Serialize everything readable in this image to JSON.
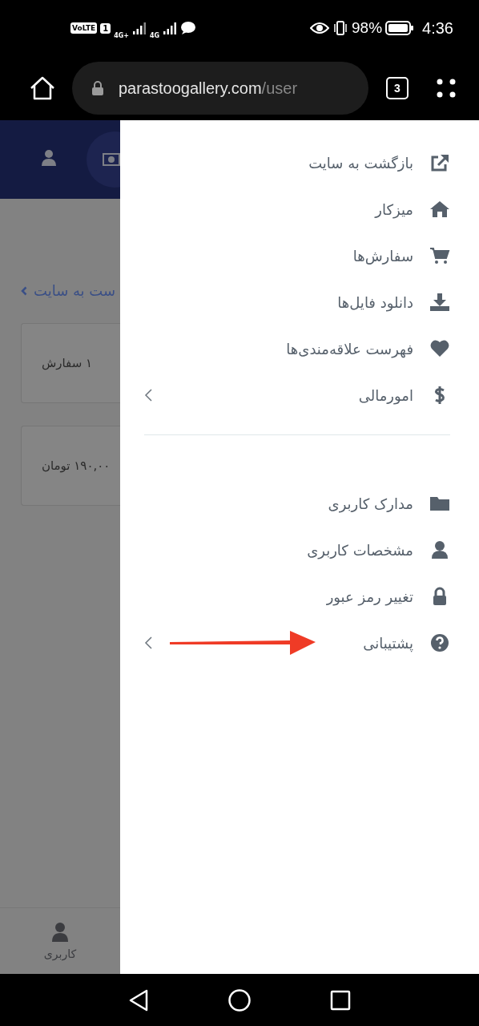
{
  "status_bar": {
    "volte": "VoLTE",
    "sim": "1",
    "network_1": "4G+",
    "network_2": "4G",
    "battery": "98%",
    "time": "4:36"
  },
  "browser": {
    "url_host": "parastoogallery.com",
    "url_path": "/user",
    "tab_count": "3"
  },
  "background_page": {
    "back_link": "ست به سایت",
    "cards": [
      "۱ سفارش",
      "۱۹۰,۰۰ تومان"
    ],
    "bottom_tab": "کاربری"
  },
  "drawer": {
    "groups": [
      {
        "items": [
          {
            "label": "بازگشت به سایت",
            "has_submenu": false
          },
          {
            "label": "میزکار",
            "has_submenu": false
          },
          {
            "label": "سفارش‌ها",
            "has_submenu": false
          },
          {
            "label": "دانلود فایل‌ها",
            "has_submenu": false
          },
          {
            "label": "فهرست علاقه‌مندی‌ها",
            "has_submenu": false
          },
          {
            "label": "امورمالی",
            "has_submenu": true
          }
        ]
      },
      {
        "items": [
          {
            "label": "مدارک کاربری",
            "has_submenu": false
          },
          {
            "label": "مشخصات کاربری",
            "has_submenu": false
          },
          {
            "label": "تغییر رمز عبور",
            "has_submenu": false
          },
          {
            "label": "پشتیبانی",
            "has_submenu": true
          }
        ]
      }
    ]
  }
}
